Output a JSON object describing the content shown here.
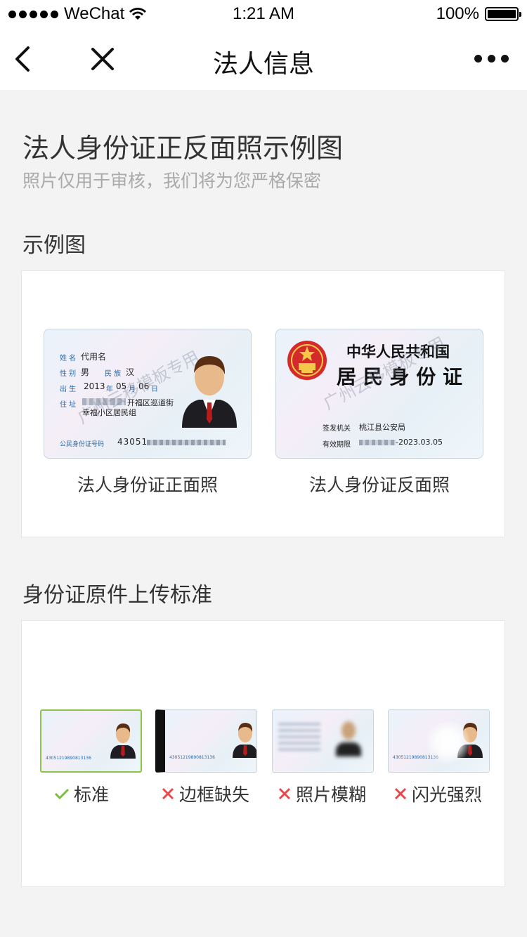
{
  "status": {
    "carrier": "WeChat",
    "time": "1:21 AM",
    "battery": "100%"
  },
  "nav": {
    "title": "法人信息"
  },
  "header": {
    "title": "法人身份证正反面照示例图",
    "subtitle": "照片仅用于审核，我们将为您严格保密"
  },
  "example": {
    "section_title": "示例图",
    "front_caption": "法人身份证正面照",
    "back_caption": "法人身份证反面照"
  },
  "id_front": {
    "name_label": "姓 名",
    "name": "代用名",
    "gender_label": "性 别",
    "gender": "男",
    "ethnic_label": "民 族",
    "ethnic": "汉",
    "birth_label": "出 生",
    "year": "2013",
    "year_unit": "年",
    "month": "05",
    "month_unit": "月",
    "day": "06",
    "day_unit": "日",
    "address_label": "住 址",
    "address_line1": "开福区巡道街",
    "address_line2": "幸福小区居民组",
    "id_label": "公民身份证号码",
    "id_number": "43051",
    "watermark": "广州云移模板专用"
  },
  "id_back": {
    "country": "中华人民共和国",
    "card_name": "居 民 身 份 证",
    "authority_label": "签发机关",
    "authority": "桃江县公安局",
    "validity_label": "有效期限",
    "validity_end": "-2023.03.05",
    "watermark": "广州云移模板专用"
  },
  "standards": {
    "section_title": "身份证原件上传标准",
    "small_id_number": "43051219890813136",
    "items": [
      {
        "label": "标准",
        "status": "ok"
      },
      {
        "label": "边框缺失",
        "status": "bad"
      },
      {
        "label": "照片模糊",
        "status": "bad"
      },
      {
        "label": "闪光强烈",
        "status": "bad"
      }
    ]
  },
  "colors": {
    "ok": "#7cbf3a",
    "bad": "#e8484a",
    "id_text": "#2a6aa8",
    "emblem_red": "#d42a2a"
  }
}
